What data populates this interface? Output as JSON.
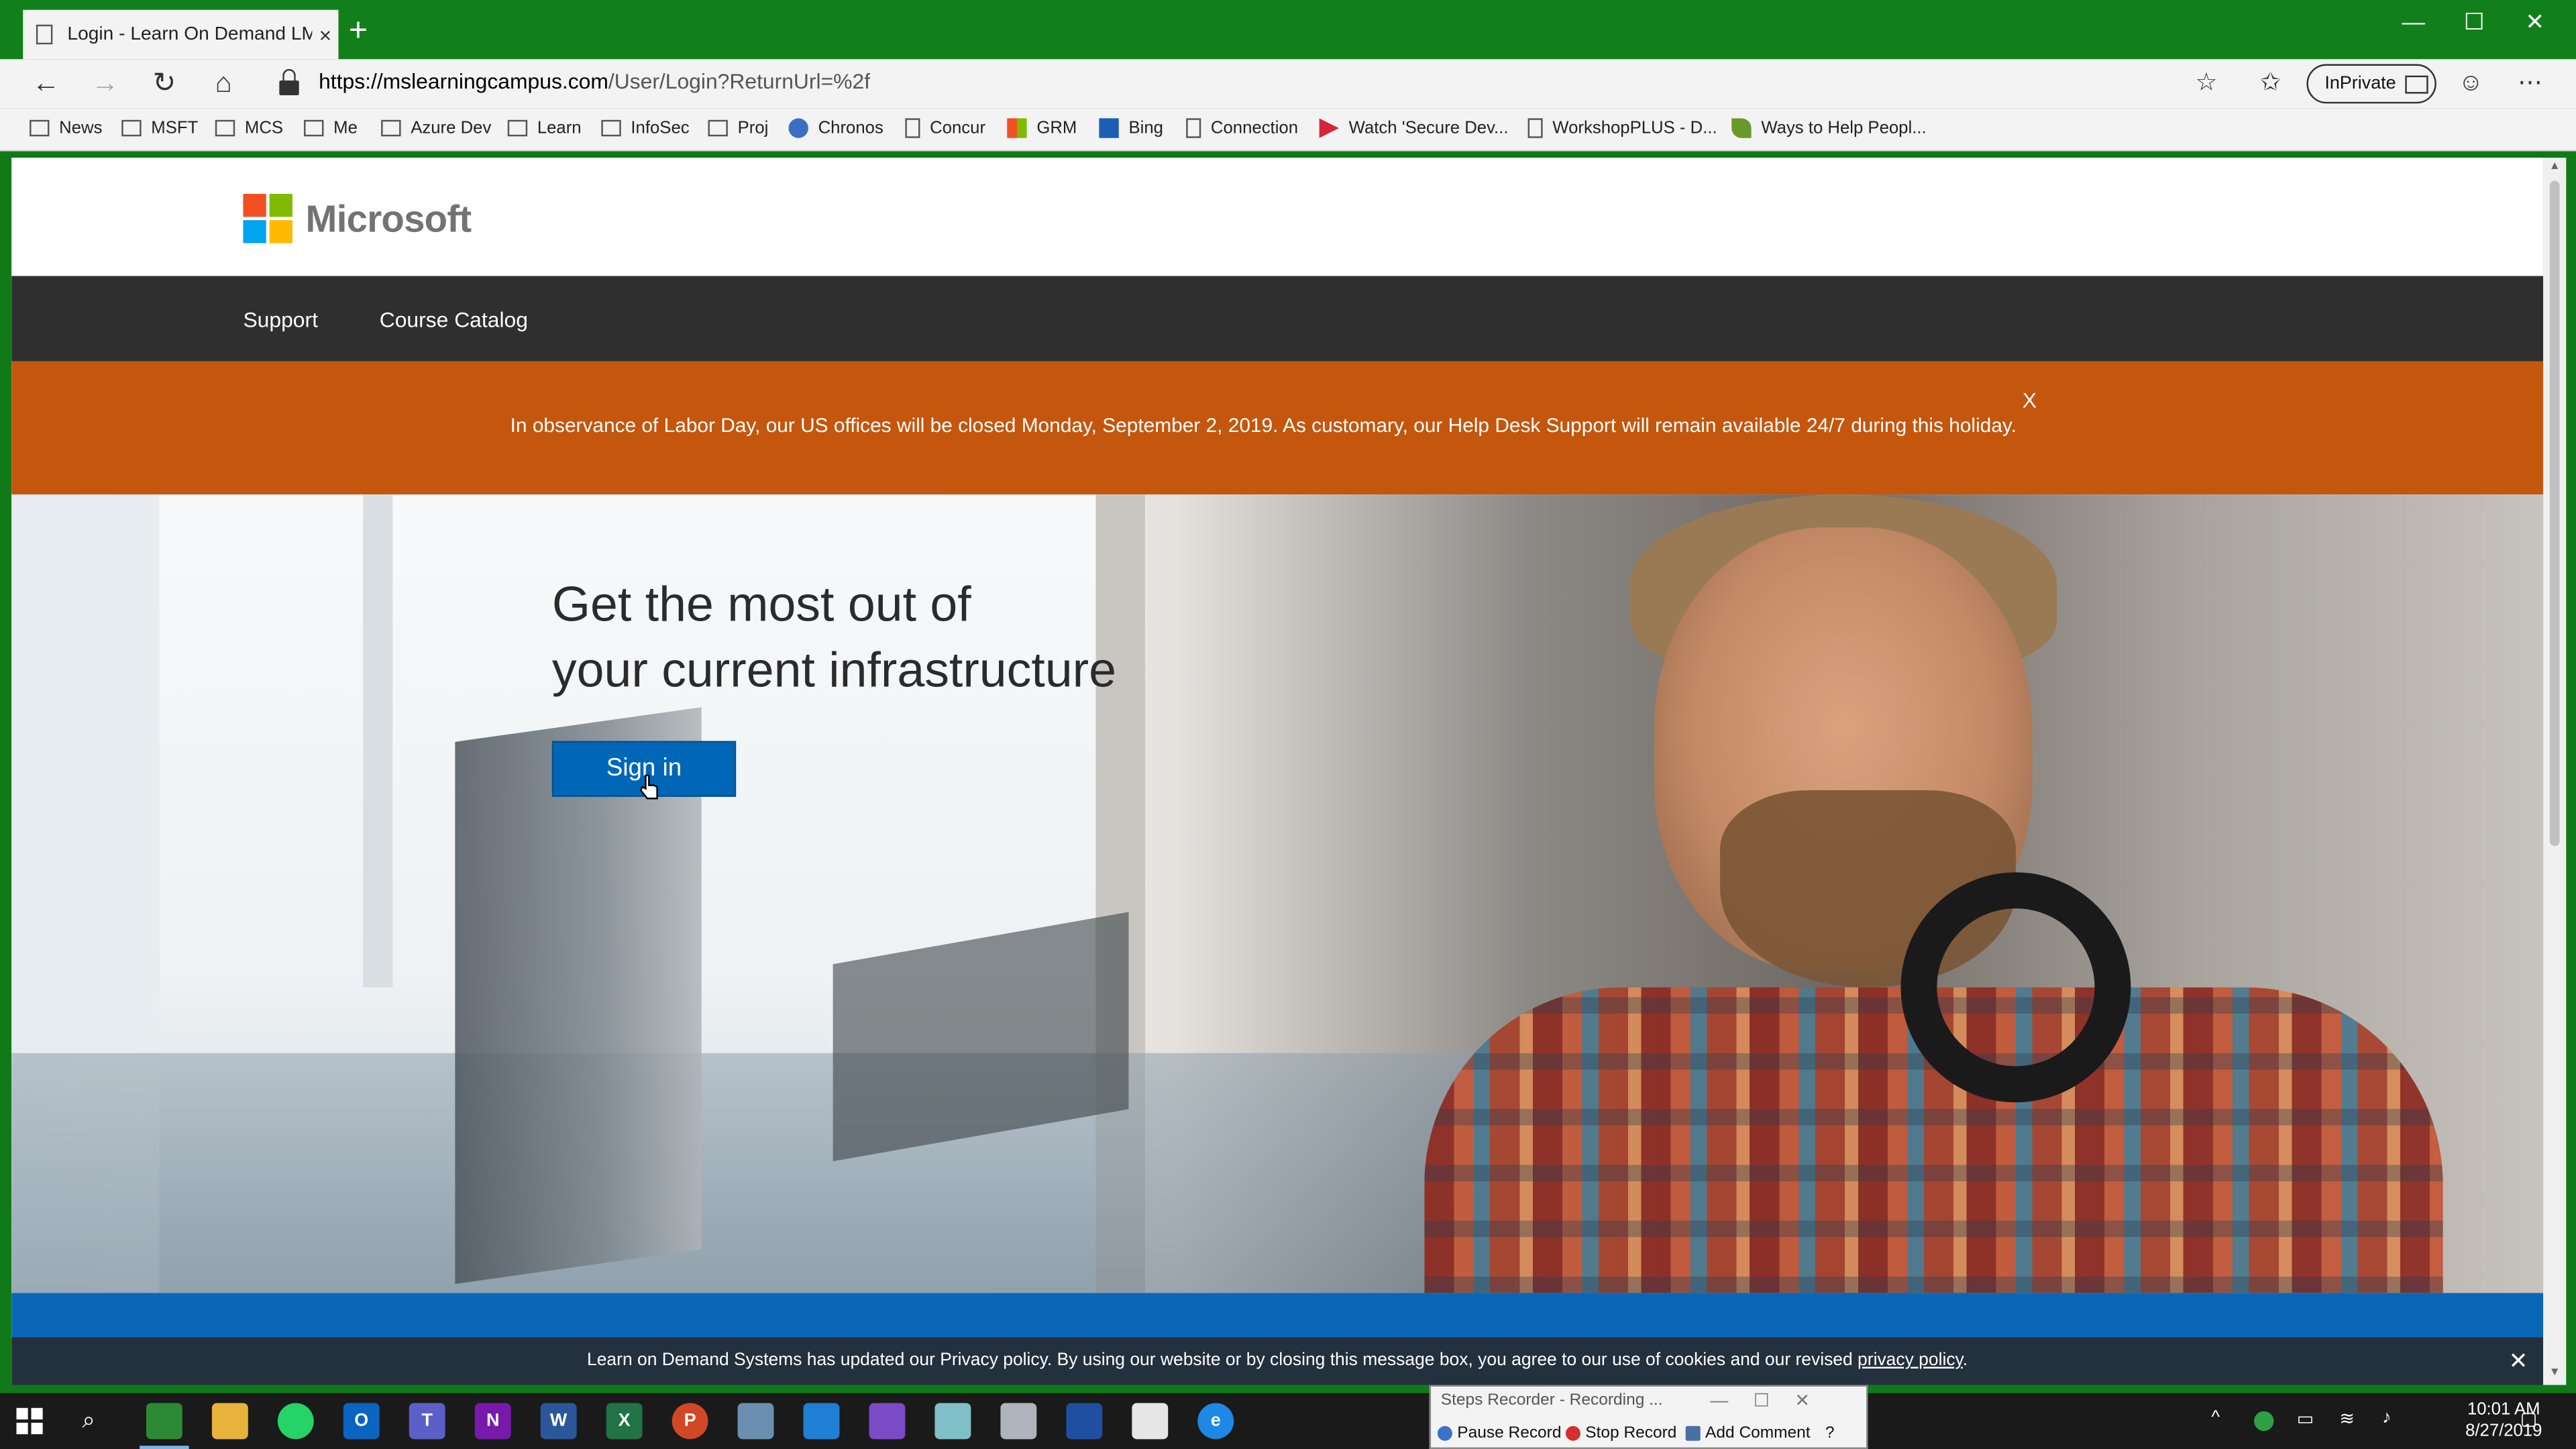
{
  "browser": {
    "tab_title": "Login - Learn On Demand LMS",
    "tab_close": "×",
    "new_tab": "+",
    "window_controls": {
      "minimize": "—",
      "maximize": "☐",
      "close": "✕"
    },
    "url_host": "https://mslearningcampus.com",
    "url_path": "/User/Login?ReturnUrl=%2f",
    "inprivate_label": "InPrivate",
    "favorites": [
      {
        "label": "News",
        "icon": "folder-icon"
      },
      {
        "label": "MSFT",
        "icon": "folder-icon"
      },
      {
        "label": "MCS",
        "icon": "folder-icon"
      },
      {
        "label": "Me",
        "icon": "folder-icon"
      },
      {
        "label": "Azure Dev",
        "icon": "folder-icon"
      },
      {
        "label": "Learn",
        "icon": "folder-icon"
      },
      {
        "label": "InfoSec",
        "icon": "folder-icon"
      },
      {
        "label": "Proj",
        "icon": "folder-icon"
      },
      {
        "label": "Chronos",
        "icon": "globe-icon"
      },
      {
        "label": "Concur",
        "icon": "page-icon"
      },
      {
        "label": "GRM",
        "icon": "ms-grid-icon"
      },
      {
        "label": "Bing",
        "icon": "bing-icon"
      },
      {
        "label": "Connection",
        "icon": "page-icon"
      },
      {
        "label": "Watch 'Secure Dev...",
        "icon": "play-icon"
      },
      {
        "label": "WorkshopPLUS - D...",
        "icon": "page-icon"
      },
      {
        "label": "Ways to Help Peopl...",
        "icon": "leaf-icon"
      }
    ]
  },
  "site": {
    "logo_text": "Microsoft",
    "nav": [
      "Support",
      "Course Catalog"
    ],
    "alert_text": "In observance of Labor Day, our US offices will be closed Monday, September 2, 2019. As customary, our Help Desk Support will remain available 24/7 during this holiday.",
    "alert_close": "X",
    "hero_line1": "Get the most out of",
    "hero_line2": "your current infrastructure",
    "signin_label": "Sign in",
    "cookie_text": "Learn on Demand Systems has updated our Privacy policy. By using our website or by closing this message box, you agree to our use of cookies and our revised ",
    "cookie_link": "privacy policy",
    "cookie_period": ".",
    "cookie_close": "✕"
  },
  "steps_recorder": {
    "title": "Steps Recorder - Recording ...",
    "pause": "Pause Record",
    "stop": "Stop Record",
    "comment": "Add Comment"
  },
  "taskbar": {
    "time": "10:01 AM",
    "date": "8/27/2019"
  },
  "colors": {
    "window_frame": "#12801a",
    "nav_bar": "#2f2f2f",
    "alert": "#c4560d",
    "signin_button": "#0067b8",
    "cookie_bar": "#23303d"
  }
}
